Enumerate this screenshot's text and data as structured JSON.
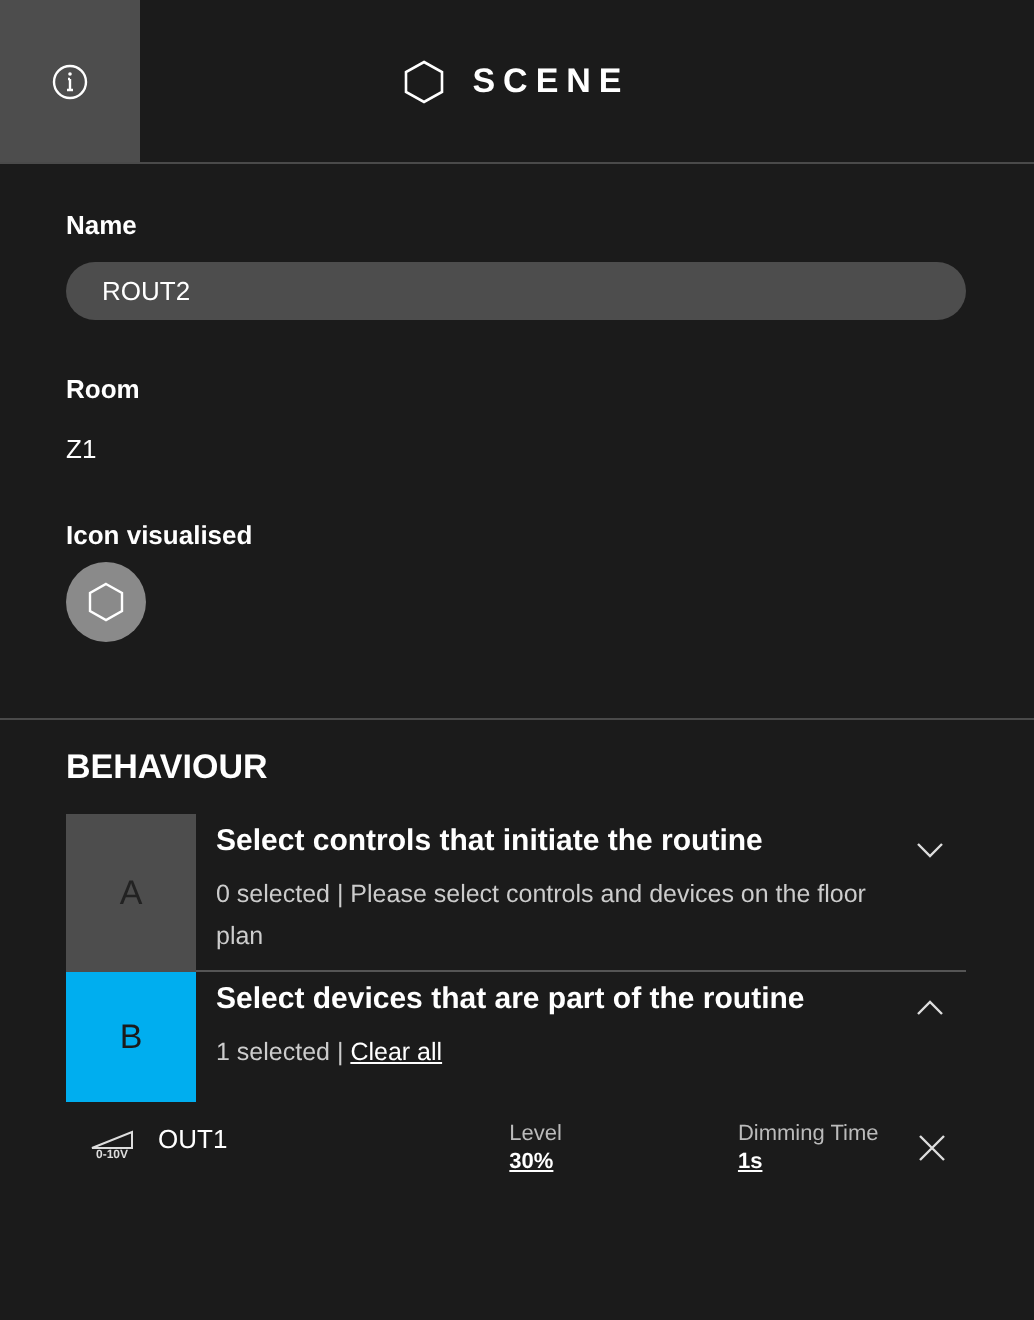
{
  "header": {
    "title": "SCENE"
  },
  "name": {
    "label": "Name",
    "value": "ROUT2"
  },
  "room": {
    "label": "Room",
    "value": "Z1"
  },
  "icon_visualised": {
    "label": "Icon visualised"
  },
  "behaviour": {
    "title": "BEHAVIOUR",
    "steps": [
      {
        "letter": "A",
        "color": "#4d4d4d",
        "title": "Select controls that initiate the routine",
        "expanded": false,
        "summary": "0 selected | Please select controls and devices on the floor plan"
      },
      {
        "letter": "B",
        "color": "#00aeef",
        "title": "Select devices that are part of the routine",
        "expanded": true,
        "summary": "1 selected | ",
        "link": "Clear all"
      }
    ],
    "devices": [
      {
        "icon_text": "0-10V",
        "name": "OUT1",
        "level_label": "Level",
        "level_value": "30%",
        "time_label": "Dimming Time",
        "time_value": "1s"
      }
    ]
  }
}
